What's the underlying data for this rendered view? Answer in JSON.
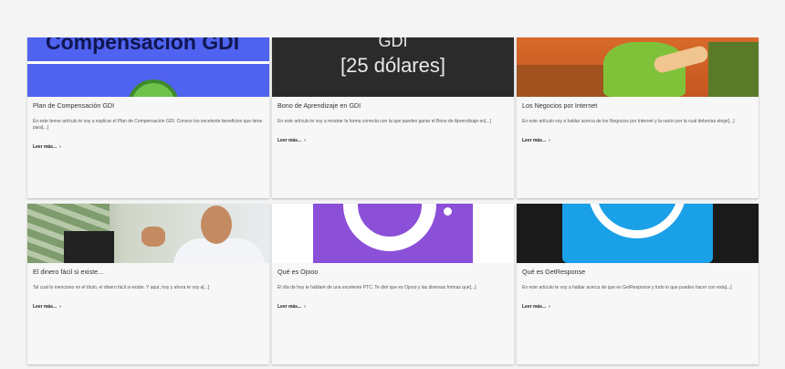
{
  "read_more_label": "Leer más...",
  "chevron_glyph": "›",
  "cards": [
    {
      "title": "Plan de Compensación GDI",
      "excerpt": "En este breve artículo te voy a explicar el Plan de Compensación GDI. Conoce los excelente beneficios que tiene para[...]",
      "thumb_text": "Compensación GDI",
      "thumb_icon": "green-circle-icon",
      "accent": "#4f62f0"
    },
    {
      "title": "Bono de Aprendizaje en GDI",
      "excerpt": "En este artículo te voy a mostrar la forma correcta con la que puedes ganar el Bono de Aprendizaje en[...]",
      "thumb_text_1": "GDI",
      "thumb_text_2": "[25 dólares]",
      "accent": "#2b2b2b"
    },
    {
      "title": "Los Negocios por Internet",
      "excerpt": "En este artículo voy a hablar acerca de los Negocios por Internet y la razón por la cual deberías elegir[...]",
      "thumb_icon": "cartoon-businessman-icon",
      "accent": "#d86a2a"
    },
    {
      "title": "El dinero fácil si existe...",
      "excerpt": "Tal cual lo menciono en el título, el dinero fácil si existe. Y aquí, hoy y ahora te voy a[...]",
      "thumb_icon": "man-with-money-photo",
      "accent": "#c48a62"
    },
    {
      "title": "Qué es Ojooo",
      "excerpt": "El día de hoy te hablaré de una excelente PTC. Te diré que es Ojooo y las diversas formas que[...]",
      "thumb_icon": "purple-camera-logo-icon",
      "accent": "#8b4fd8"
    },
    {
      "title": "Qué es GetResponse",
      "excerpt": "En este artículo te voy a hablar acerca de que es GetResponse y todo lo que puedes hacer con esta[...]",
      "thumb_icon": "getresponse-logo-icon",
      "accent": "#1aa0e6"
    }
  ]
}
